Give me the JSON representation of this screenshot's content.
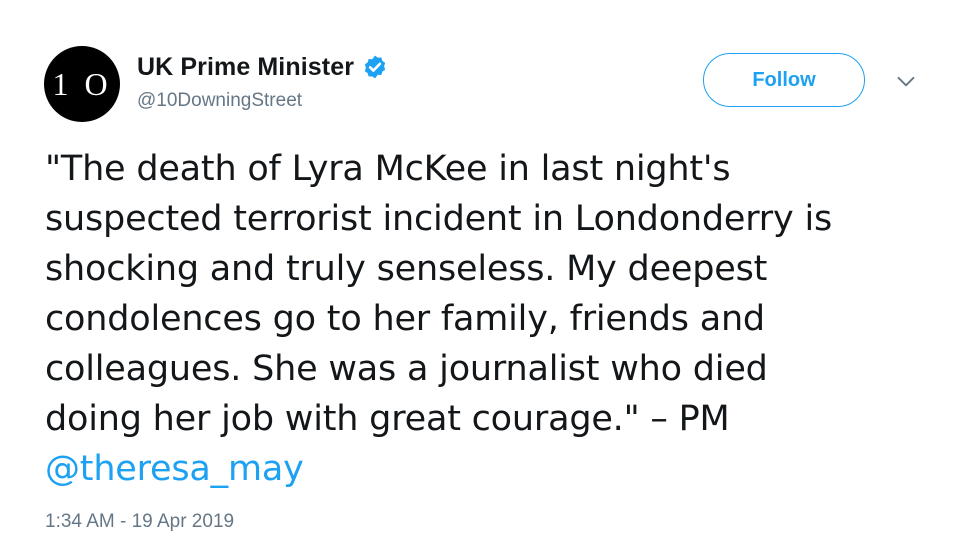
{
  "account": {
    "avatar_text": "1 O",
    "display_name": "UK Prime Minister",
    "handle": "@10DowningStreet",
    "verified_icon": "verified-badge-icon"
  },
  "actions": {
    "follow_label": "Follow",
    "more_icon": "chevron-down-icon"
  },
  "tweet": {
    "text_lines": "\"The death of Lyra McKee in last night's\nsuspected terrorist incident in Londonderry is\nshocking and truly senseless. My deepest\ncondolences go to her family, friends and\ncolleagues. She was a journalist who died\ndoing her job with great courage.\" – PM",
    "mention": "@theresa_may",
    "timestamp": "1:34 AM - 19 Apr 2019"
  },
  "colors": {
    "accent": "#1da1f2",
    "text": "#14171a",
    "secondary": "#657786"
  }
}
